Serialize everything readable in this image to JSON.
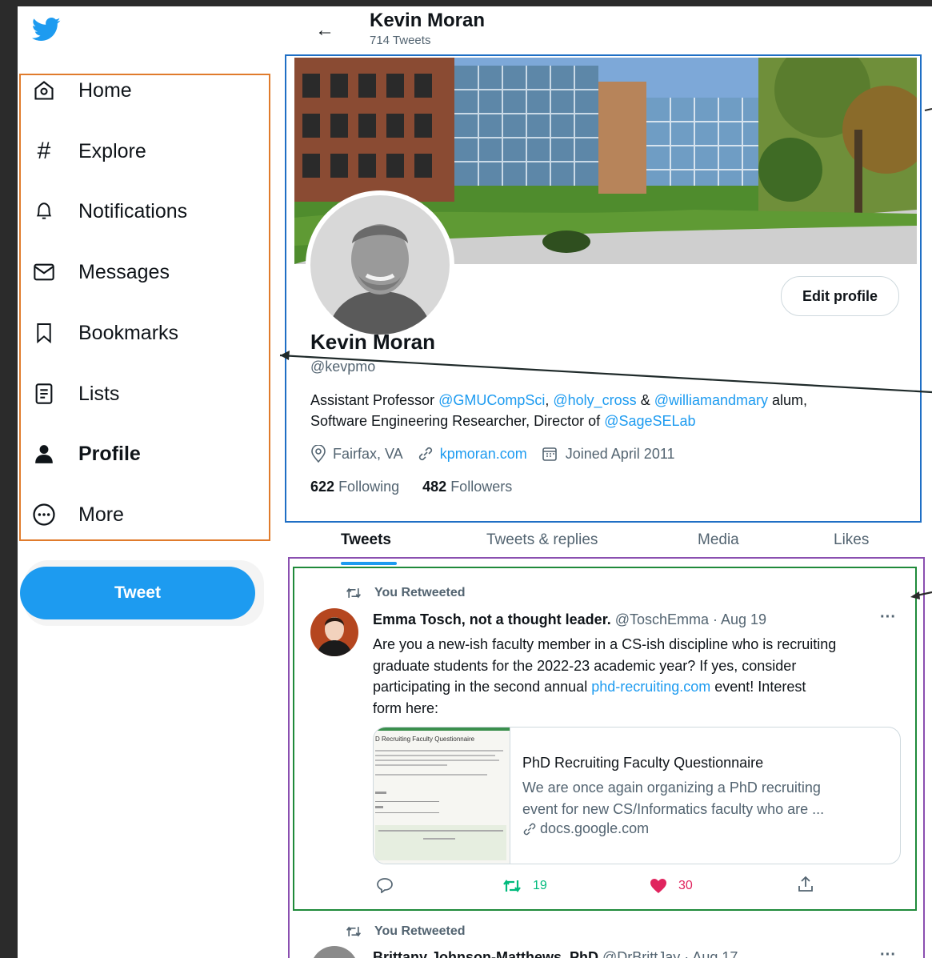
{
  "header": {
    "title": "Kevin Moran",
    "tweet_count": "714 Tweets"
  },
  "nav": {
    "items": [
      {
        "label": "Home",
        "icon": "home-icon"
      },
      {
        "label": "Explore",
        "icon": "hashtag-icon"
      },
      {
        "label": "Notifications",
        "icon": "bell-icon"
      },
      {
        "label": "Messages",
        "icon": "envelope-icon"
      },
      {
        "label": "Bookmarks",
        "icon": "bookmark-icon"
      },
      {
        "label": "Lists",
        "icon": "list-icon"
      },
      {
        "label": "Profile",
        "icon": "person-icon"
      },
      {
        "label": "More",
        "icon": "more-circle-icon"
      }
    ],
    "tweet_button": "Tweet"
  },
  "profile": {
    "edit_button": "Edit profile",
    "name": "Kevin Moran",
    "handle": "@kevpmo",
    "bio": {
      "t1": "Assistant Professor ",
      "m1": "@GMUCompSci",
      "t2": ", ",
      "m2": "@holy_cross",
      "t3": " & ",
      "m3": "@williamandmary",
      "t4": " alum,",
      "t5": "Software Engineering Researcher, Director of ",
      "m4": "@SageSELab"
    },
    "location": "Fairfax, VA",
    "website": "kpmoran.com",
    "joined": "Joined April 2011",
    "following_count": "622",
    "following_label": "Following",
    "followers_count": "482",
    "followers_label": "Followers"
  },
  "tabs": [
    "Tweets",
    "Tweets & replies",
    "Media",
    "Likes"
  ],
  "tweets": [
    {
      "retweet_label": "You Retweeted",
      "author": "Emma Tosch, not a thought leader.",
      "meta": "@ToschEmma · Aug 19",
      "text1": "Are you a new-ish faculty member in a CS-ish discipline who is recruiting",
      "text2": "graduate students for the 2022-23 academic year? If yes, consider",
      "text3a": "participating in the second annual ",
      "text3link": "phd-recruiting.com",
      "text3b": " event! Interest",
      "text4": "form here:",
      "card": {
        "thumb_title": "D Recruiting Faculty Questionnaire",
        "title": "PhD Recruiting Faculty Questionnaire",
        "desc1": "We are once again organizing a PhD recruiting",
        "desc2": "event for new CS/Informatics faculty who are ...",
        "domain": "docs.google.com"
      },
      "retweets": "19",
      "likes": "30"
    },
    {
      "retweet_label": "You Retweeted",
      "author": "Brittany Johnson-Matthews, PhD",
      "meta": "@DrBrittJay · Aug 17"
    }
  ],
  "colors": {
    "accent": "#1d9bf0",
    "orange_box": "#e07b2c",
    "blue_box": "#1f6fc5",
    "purple_box": "#8a4fb0",
    "green_box": "#1f8a3a",
    "like": "#e0245e",
    "retweet": "#00ba7c"
  }
}
